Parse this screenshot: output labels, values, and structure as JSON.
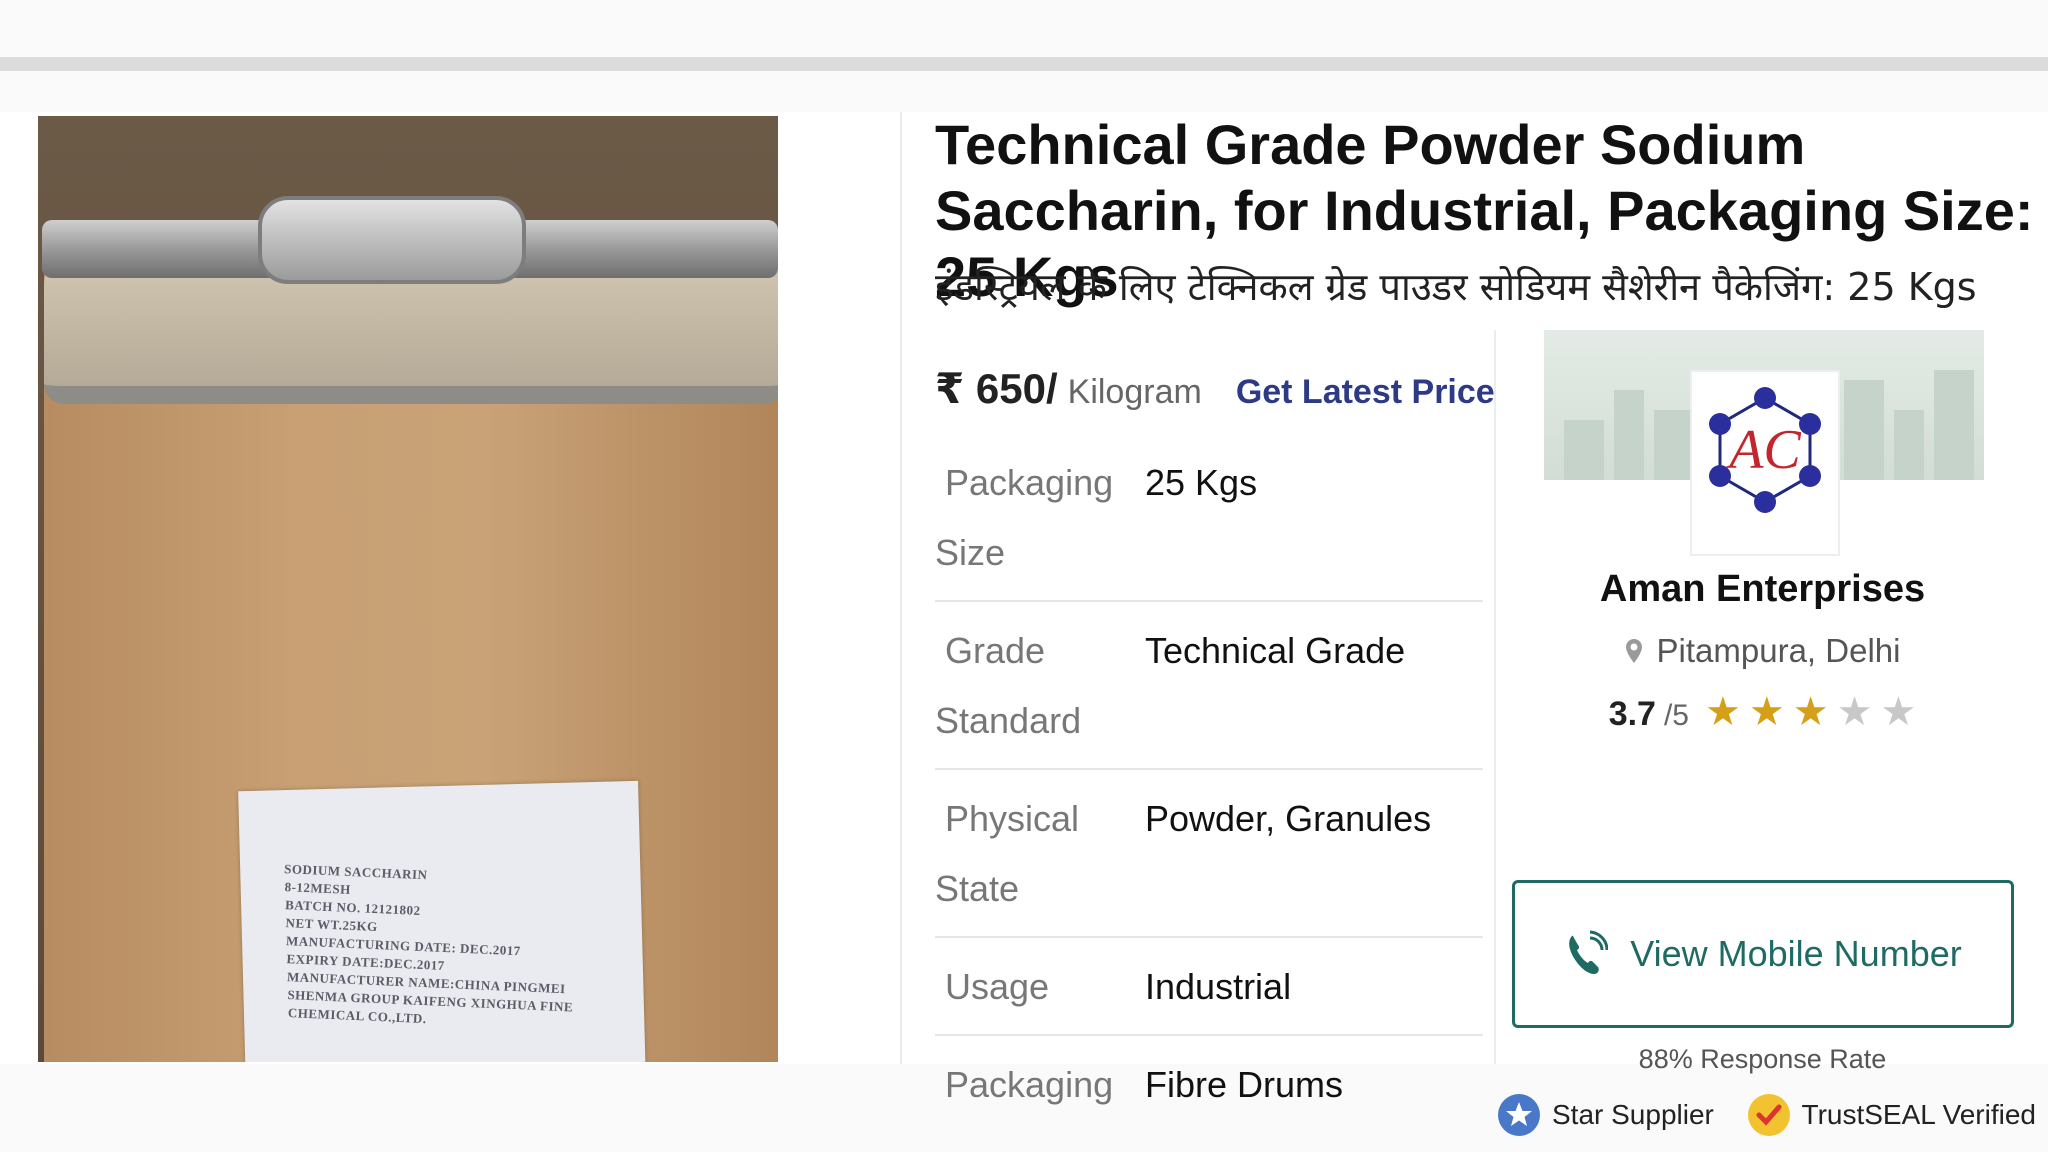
{
  "product": {
    "title": "Technical Grade Powder Sodium Saccharin, for Industrial, Packaging Size: 25 Kgs",
    "title_hindi": "इंडस्ट्रियल के लिए टेक्निकल ग्रेड पाउडर सोडियम सैशेरीन पैकेजिंग: 25 Kgs",
    "image_label_lines": [
      "SODIUM SACCHARIN",
      "8-12MESH",
      "BATCH NO. 12121802",
      "NET WT.25KG",
      "MANUFACTURING DATE: DEC.2017",
      "EXPIRY DATE:DEC.2017",
      "MANUFACTURER NAME:CHINA PINGMEI",
      "SHENMA GROUP KAIFENG XINGHUA FINE",
      "CHEMICAL CO.,LTD."
    ]
  },
  "price": {
    "amount": "₹ 650/",
    "unit": "Kilogram",
    "latest_price_link": "Get Latest Price"
  },
  "specs": [
    {
      "key_line1": "Packaging",
      "key_line2": "Size",
      "value": "25 Kgs"
    },
    {
      "key_line1": "Grade",
      "key_line2": "Standard",
      "value": "Technical Grade"
    },
    {
      "key_line1": "Physical",
      "key_line2": "State",
      "value": "Powder, Granules"
    },
    {
      "key_line1": "Usage",
      "key_line2": "",
      "value": "Industrial"
    },
    {
      "key_line1": "Packaging",
      "key_line2": "",
      "value": "Fibre Drums"
    }
  ],
  "seller": {
    "logo_letters": "AC",
    "name": "Aman Enterprises",
    "location": "Pitampura, Delhi",
    "rating": "3.7",
    "rating_max": "/5",
    "rating_value": 3.7,
    "stars_filled": 3,
    "stars_total": 5,
    "mobile_button": "View Mobile Number",
    "response_rate": "88% Response Rate",
    "badge_star": "Star Supplier",
    "badge_trust": "TrustSEAL Verified"
  },
  "colors": {
    "accent_link": "#2d3a86",
    "button_teal": "#1f6b64",
    "star_gold": "#d4a017"
  }
}
